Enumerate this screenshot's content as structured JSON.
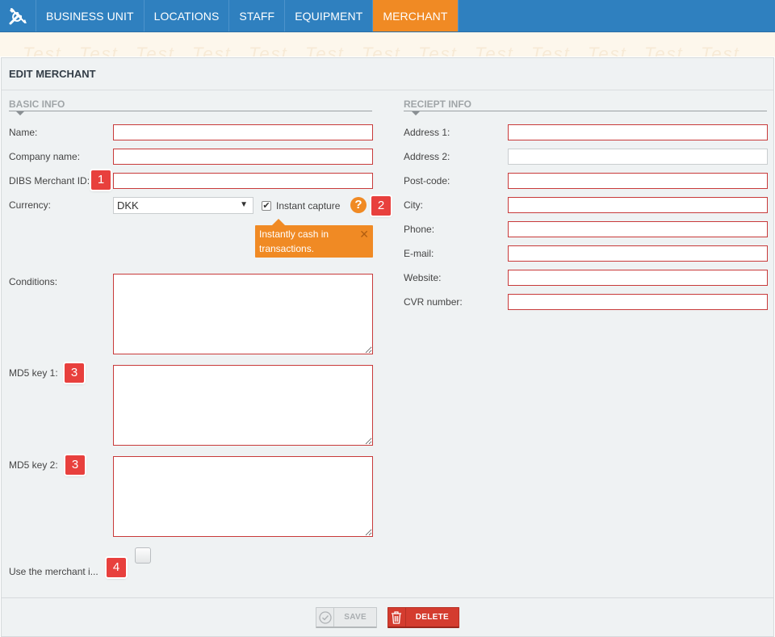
{
  "nav": {
    "tabs": [
      {
        "label": "BUSINESS UNIT"
      },
      {
        "label": "LOCATIONS"
      },
      {
        "label": "STAFF"
      },
      {
        "label": "EQUIPMENT"
      },
      {
        "label": "MERCHANT",
        "active": true
      }
    ],
    "accent_color": "#f08a24",
    "bar_color": "#2f80bf",
    "tools_icon": "tools-icon"
  },
  "watermark": "Test",
  "panel": {
    "title": "EDIT MERCHANT"
  },
  "basic_info": {
    "title": "BASIC INFO",
    "name_label": "Name:",
    "company_label": "Company name:",
    "merchant_id_label": "DIBS Merchant ID:",
    "currency_label": "Currency:",
    "currency_value": "DKK",
    "instant_capture_label": "Instant capture",
    "instant_capture_checked": true,
    "tooltip_text": "Instantly cash in transactions.",
    "tooltip_close": "✕",
    "conditions_label": "Conditions:",
    "md5_key1_label": "MD5 key 1:",
    "md5_key2_label": "MD5 key 2:",
    "use_merchant_label": "Use the merchant i...",
    "help_glyph": "?"
  },
  "receipt_info": {
    "title": "RECIEPT INFO",
    "address1_label": "Address 1:",
    "address2_label": "Address 2:",
    "postcode_label": "Post-code:",
    "city_label": "City:",
    "phone_label": "Phone:",
    "email_label": "E-mail:",
    "website_label": "Website:",
    "cvr_label": "CVR number:"
  },
  "badges": [
    "1",
    "2",
    "3",
    "3",
    "4"
  ],
  "buttons": {
    "save": "SAVE",
    "delete": "DELETE"
  }
}
